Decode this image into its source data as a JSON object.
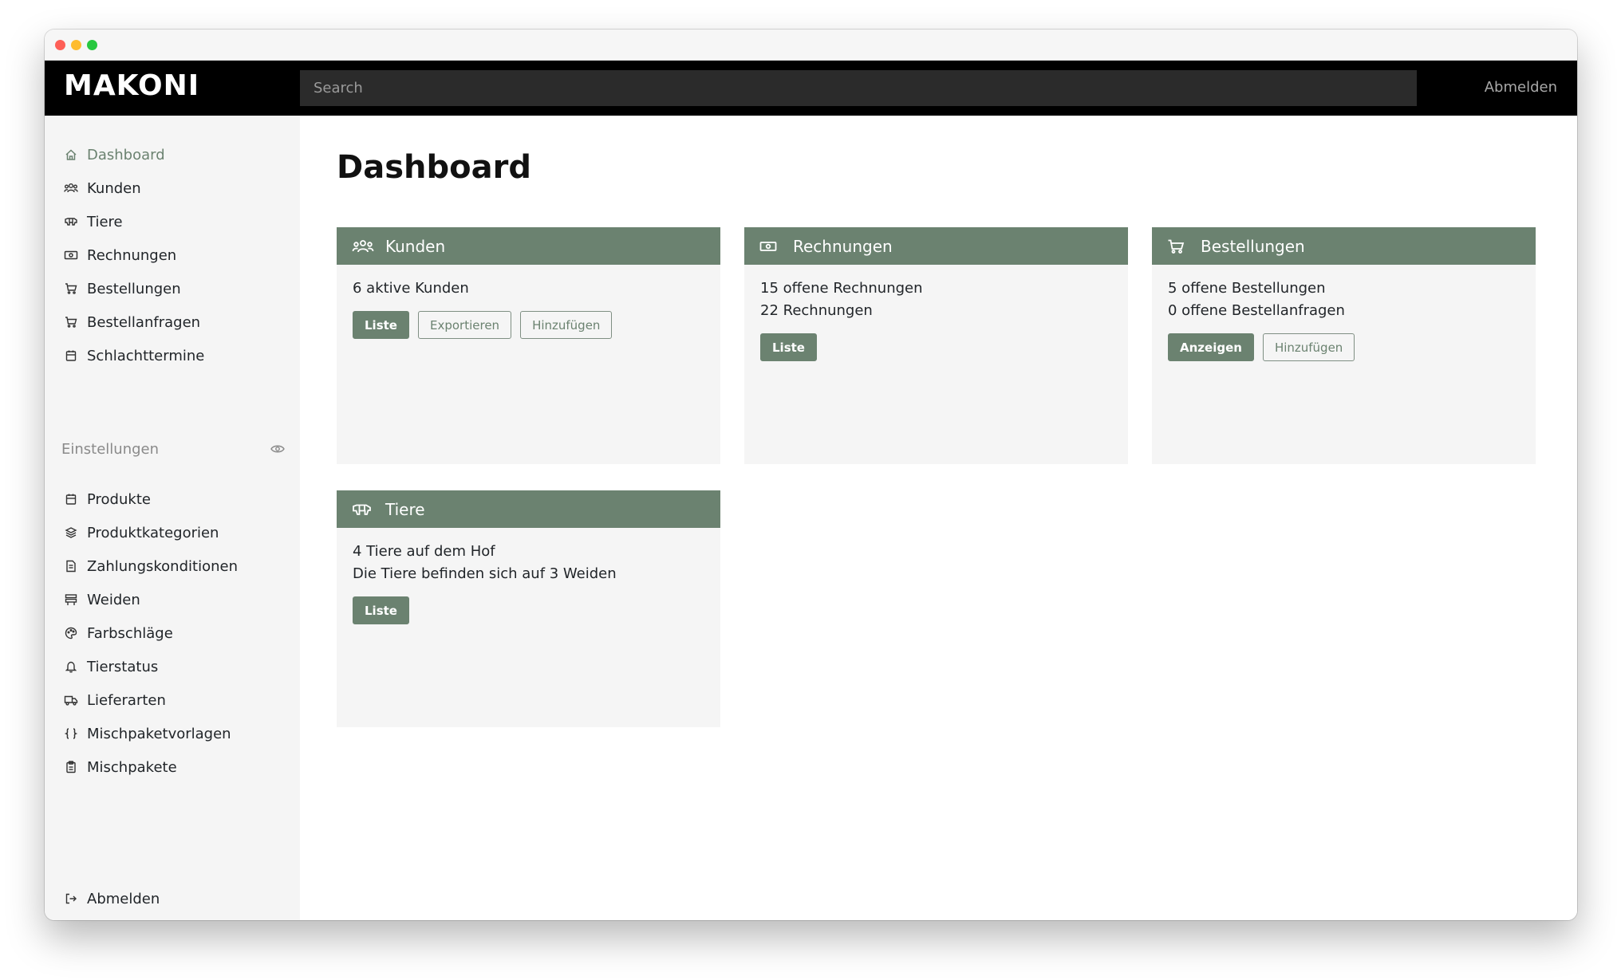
{
  "navbar": {
    "brand": "MAKONI",
    "search_placeholder": "Search",
    "logout": "Abmelden"
  },
  "sidebar": {
    "items": [
      {
        "label": "Dashboard",
        "icon": "home-icon",
        "active": true
      },
      {
        "label": "Kunden",
        "icon": "users-icon"
      },
      {
        "label": "Tiere",
        "icon": "cow-icon"
      },
      {
        "label": "Rechnungen",
        "icon": "cash-icon"
      },
      {
        "label": "Bestellungen",
        "icon": "cart-icon"
      },
      {
        "label": "Bestellanfragen",
        "icon": "cart-icon"
      },
      {
        "label": "Schlachttermine",
        "icon": "calendar-icon"
      }
    ],
    "settings_heading": "Einstellungen",
    "settings_items": [
      {
        "label": "Produkte",
        "icon": "box-icon"
      },
      {
        "label": "Produktkategorien",
        "icon": "layers-icon"
      },
      {
        "label": "Zahlungskonditionen",
        "icon": "document-icon"
      },
      {
        "label": "Weiden",
        "icon": "fence-icon"
      },
      {
        "label": "Farbschläge",
        "icon": "palette-icon"
      },
      {
        "label": "Tierstatus",
        "icon": "bell-icon"
      },
      {
        "label": "Lieferarten",
        "icon": "truck-icon"
      },
      {
        "label": "Mischpaketvorlagen",
        "icon": "braces-icon"
      },
      {
        "label": "Mischpakete",
        "icon": "clipboard-icon"
      }
    ],
    "logout": "Abmelden"
  },
  "main": {
    "title": "Dashboard",
    "cards": {
      "kunden": {
        "title": "Kunden",
        "lines": [
          "6 aktive Kunden"
        ],
        "buttons": [
          "Liste",
          "Exportieren",
          "Hinzufügen"
        ]
      },
      "rechnungen": {
        "title": "Rechnungen",
        "lines": [
          "15 offene Rechnungen",
          "22 Rechnungen"
        ],
        "buttons": [
          "Liste"
        ]
      },
      "bestellungen": {
        "title": "Bestellungen",
        "lines": [
          "5 offene Bestellungen",
          "0 offene Bestellanfragen"
        ],
        "buttons": [
          "Anzeigen",
          "Hinzufügen"
        ]
      },
      "tiere": {
        "title": "Tiere",
        "lines": [
          "4 Tiere auf dem Hof",
          "Die Tiere befinden sich auf 3 Weiden"
        ],
        "buttons": [
          "Liste"
        ]
      }
    }
  },
  "colors": {
    "accent": "#6b8270",
    "navbar": "#000000",
    "sidebar": "#f5f5f5",
    "card": "#f5f5f5"
  }
}
